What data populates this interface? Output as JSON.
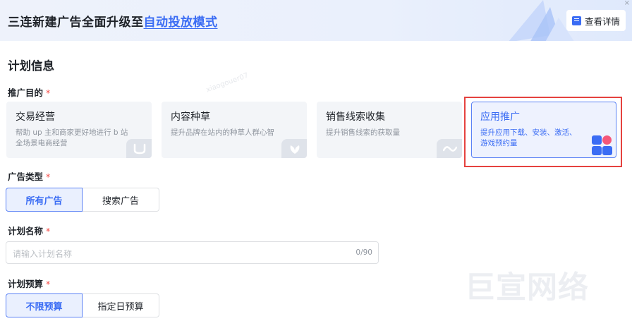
{
  "banner": {
    "title_prefix": "三连新建广告全面升级至",
    "title_link": "自动投放模式",
    "detail_button": "查看详情",
    "close": "×"
  },
  "section_title": "计划信息",
  "required_mark": "*",
  "promotion_goal": {
    "label": "推广目的",
    "cards": [
      {
        "title": "交易经营",
        "desc": "帮助 up 主和商家更好地进行 b 站全场景电商经营",
        "icon": "bag-icon"
      },
      {
        "title": "内容种草",
        "desc": "提升品牌在站内的种草人群心智",
        "icon": "leaf-icon"
      },
      {
        "title": "销售线索收集",
        "desc": "提升销售线索的获取量",
        "icon": "wave-icon"
      },
      {
        "title": "应用推广",
        "desc": "提升应用下载、安装、激活、游戏预约量",
        "icon": "app-grid-icon",
        "selected": true
      }
    ]
  },
  "ad_type": {
    "label": "广告类型",
    "options": [
      "所有广告",
      "搜索广告"
    ],
    "selected": "所有广告"
  },
  "plan_name": {
    "label": "计划名称",
    "placeholder": "请输入计划名称",
    "counter": "0/90"
  },
  "budget": {
    "label": "计划预算",
    "options": [
      "不限预算",
      "指定日预算"
    ],
    "selected": "不限预算"
  },
  "watermark": "巨宣网络",
  "colors": {
    "accent": "#3a6cf4",
    "highlight_box": "#e5423f",
    "required": "#f54a45"
  }
}
